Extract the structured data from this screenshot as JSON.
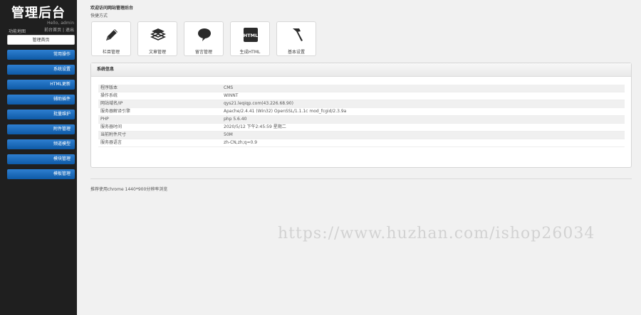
{
  "sidebar": {
    "logo": "管理后台",
    "greeting": "Hello, admin",
    "func_map": "功能地图",
    "link_home": "前台首页",
    "link_sep": " | ",
    "link_logout": "退出",
    "menu": [
      {
        "label": "管理首页"
      },
      {
        "label": "常用操作"
      },
      {
        "label": "系统设置"
      },
      {
        "label": "HTML更新"
      },
      {
        "label": "辅助插件"
      },
      {
        "label": "批量维护"
      },
      {
        "label": "附件管理"
      },
      {
        "label": "频道模型"
      },
      {
        "label": "模块管理"
      },
      {
        "label": "模板管理"
      }
    ]
  },
  "main": {
    "welcome": "欢迎访问网站管理后台",
    "quick_title": "快捷方式",
    "shortcuts": [
      {
        "label": "栏目管理",
        "icon": "pencil-icon"
      },
      {
        "label": "文章管理",
        "icon": "stack-icon"
      },
      {
        "label": "留言管理",
        "icon": "speech-bubble-icon"
      },
      {
        "label": "生成HTML",
        "icon": "html-icon",
        "icon_text": "HTML"
      },
      {
        "label": "基本设置",
        "icon": "hammer-icon"
      }
    ],
    "system_panel": {
      "title": "系统信息",
      "rows": [
        {
          "k": "程序版本",
          "v": "CMS"
        },
        {
          "k": "操作系统",
          "v": "WINNT"
        },
        {
          "k": "网站域名/IP",
          "v": "qys21.leqiqp.com(43.226.68.90)"
        },
        {
          "k": "服务器解译引擎",
          "v": "Apache/2.4.41 (Win32) OpenSSL/1.1.1c mod_fcgid/2.3.9a"
        },
        {
          "k": "PHP",
          "v": "php 5.6.40"
        },
        {
          "k": "服务器时间",
          "v": "2020/5/12 下午2:45:59 星期二"
        },
        {
          "k": "当前附件尺寸",
          "v": "50M"
        },
        {
          "k": "服务器语言",
          "v": "zh-CN,zh;q=0.9"
        }
      ]
    },
    "browser_tip": "推荐使用chrome 1440*900分辨率浏览"
  },
  "watermark": "https://www.huzhan.com/ishop26034"
}
